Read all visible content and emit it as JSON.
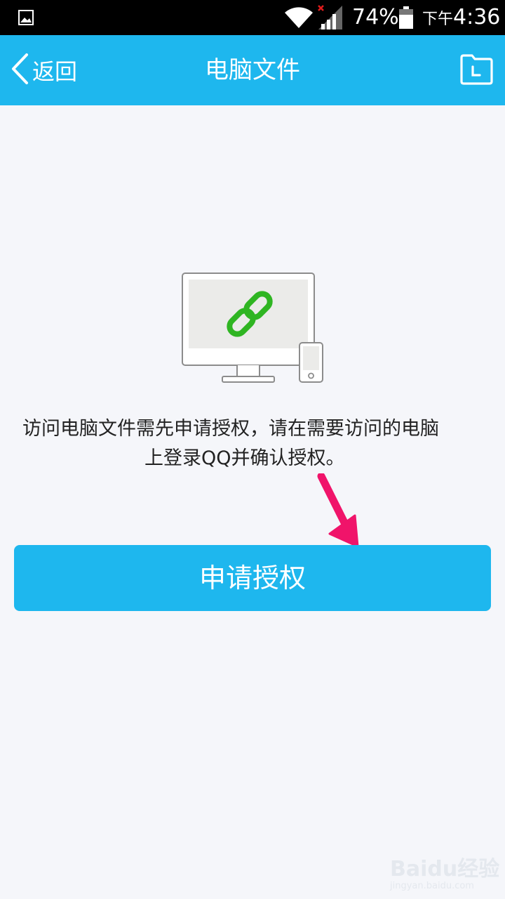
{
  "status_bar": {
    "battery_percent": "74%",
    "time_prefix": "下午",
    "time": "4:36",
    "icons": [
      "gallery-icon",
      "wifi-icon",
      "signal-icon",
      "battery-icon"
    ]
  },
  "nav": {
    "back_label": "返回",
    "title": "电脑文件",
    "right_icon": "folder-icon"
  },
  "illustration": {
    "icons": [
      "monitor-icon",
      "link-icon",
      "phone-icon"
    ],
    "link_color": "#2fb522"
  },
  "description": {
    "line1": "访问电脑文件需先申请授权，请在需要访问的电脑",
    "line2": "上登录QQ并确认授权。"
  },
  "authorize_button": {
    "label": "申请授权"
  },
  "watermark": {
    "brand": "Baidu经验",
    "url": "jingyan.baidu.com"
  },
  "colors": {
    "accent": "#1eb7ee",
    "background": "#f5f6fa",
    "arrow": "#f0146a"
  }
}
